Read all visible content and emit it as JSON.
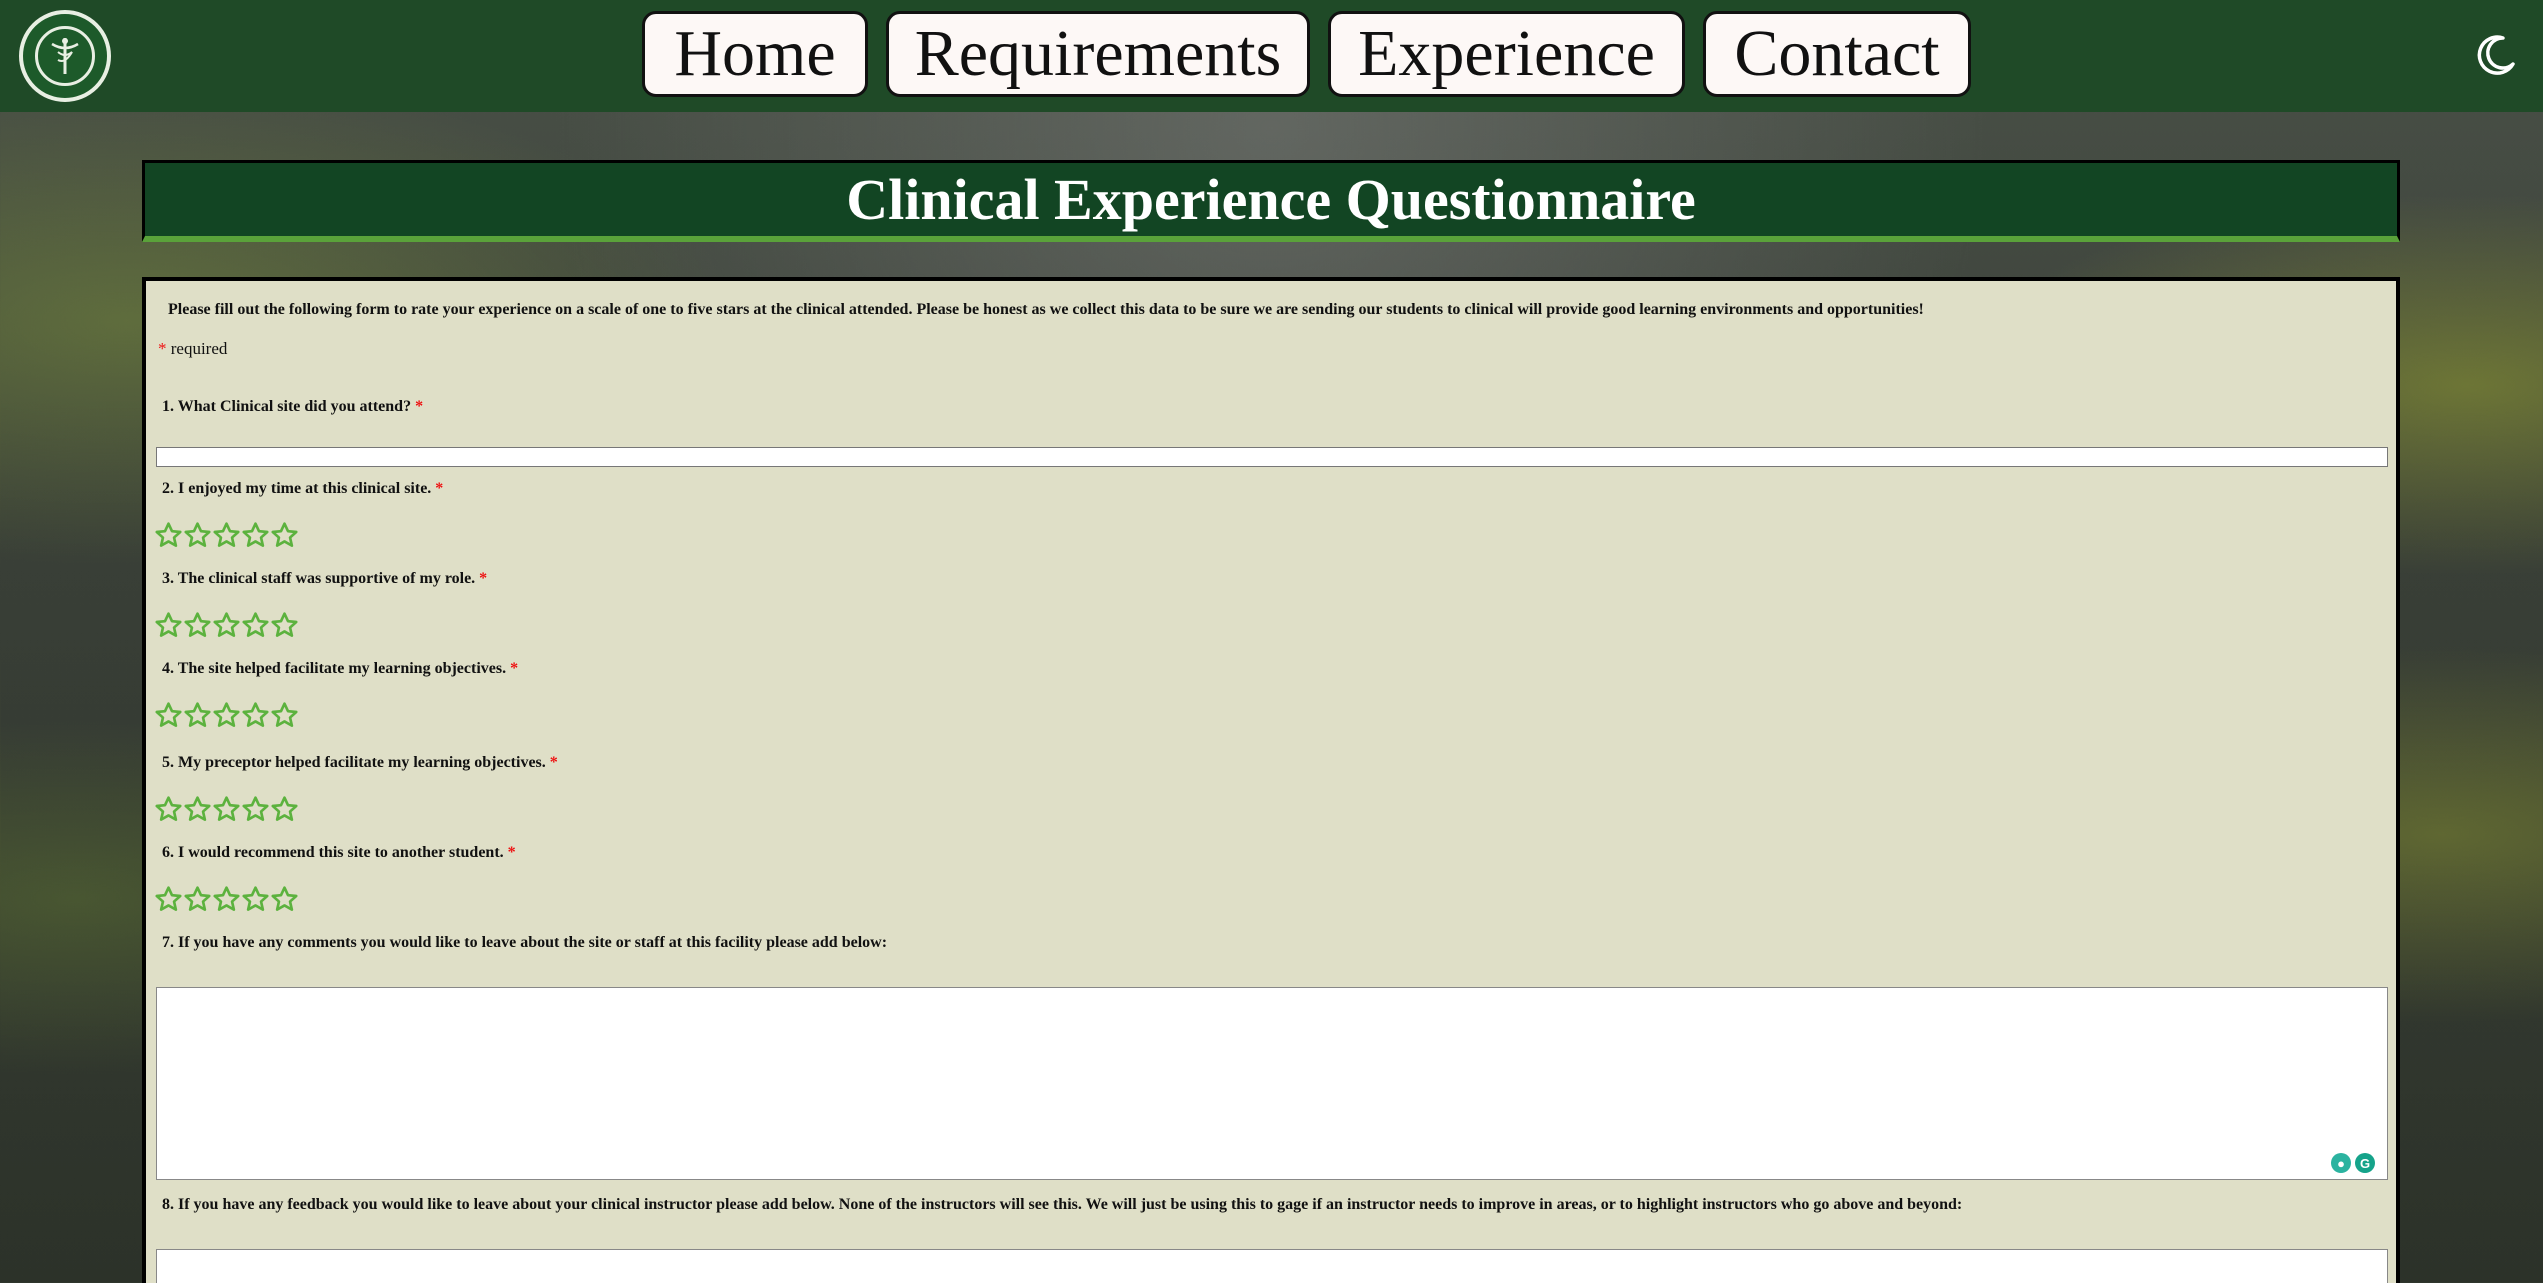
{
  "logo": {
    "icon": "caduceus-seal-icon"
  },
  "nav": {
    "items": [
      "Home",
      "Requirements",
      "Experience",
      "Contact"
    ]
  },
  "theme_toggle": {
    "icon": "moon-icon"
  },
  "page": {
    "title": "Clinical Experience Questionnaire"
  },
  "form": {
    "intro": "Please fill out the following form to rate your experience on a scale of one to five stars at the clinical attended. Please be honest as we collect this data to be sure we are sending our students to clinical will provide good learning environments and opportunities!",
    "required_marker": "*",
    "required_note": "required",
    "questions": [
      {
        "label": "1. What Clinical site did you attend?",
        "required": "*",
        "type": "text",
        "value": ""
      },
      {
        "label": "2. I enjoyed my time at this clinical site.",
        "required": "*",
        "type": "rating",
        "rating": 0,
        "max": 5
      },
      {
        "label": "3. The clinical staff was supportive of my role.",
        "required": "*",
        "type": "rating",
        "rating": 0,
        "max": 5
      },
      {
        "label": "4. The site helped facilitate my learning objectives.",
        "required": "*",
        "type": "rating",
        "rating": 0,
        "max": 5
      },
      {
        "label": "5. My preceptor helped facilitate my learning objectives.",
        "required": "*",
        "type": "rating",
        "rating": 0,
        "max": 5
      },
      {
        "label": "6. I would recommend this site to another student.",
        "required": "*",
        "type": "rating",
        "rating": 0,
        "max": 5
      },
      {
        "label": "7. If you have any comments you would like to leave about the site or staff at this facility please add below:",
        "required": "",
        "type": "textarea",
        "value": ""
      },
      {
        "label": "8. If you have any feedback you would like to leave about your clinical instructor please add below. None of the instructors will see this. We will just be using this to gage if an instructor needs to improve in areas, or to highlight instructors who go above and beyond:",
        "required": "",
        "type": "textarea",
        "value": ""
      }
    ]
  },
  "colors": {
    "header_bg": "#1f4a27",
    "title_bg": "#124523",
    "title_underline": "#5aa23a",
    "panel_bg": "#dfdfc7",
    "star_color": "#5cb23e",
    "required_color": "#ee1111"
  }
}
